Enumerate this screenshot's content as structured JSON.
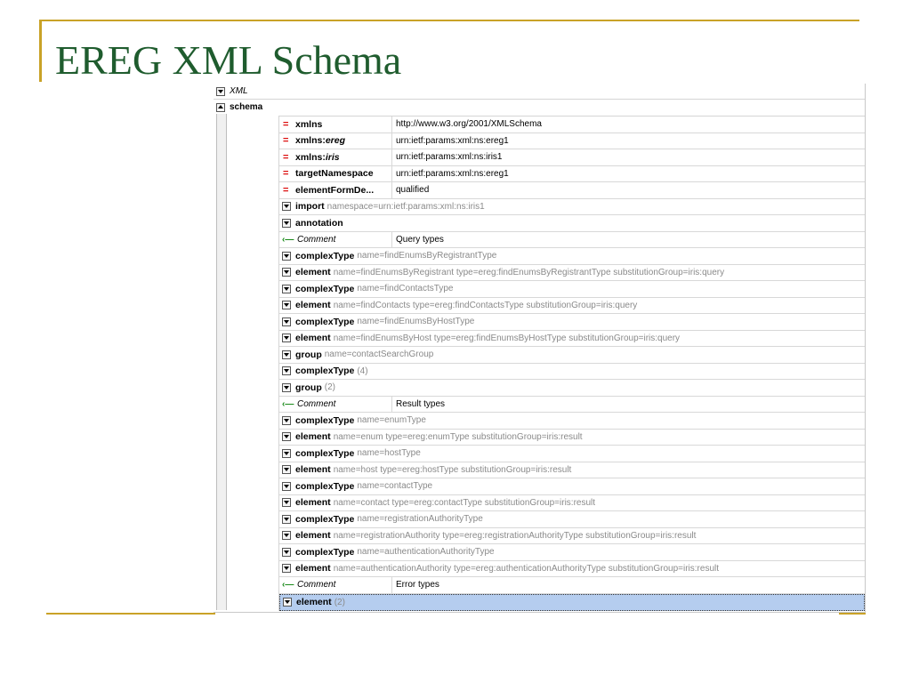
{
  "slide": {
    "title": "EREG XML Schema"
  },
  "grid": {
    "root_label": "XML",
    "schema_label": "schema",
    "attributes": [
      {
        "name": "xmlns",
        "value": "http://www.w3.org/2001/XMLSchema"
      },
      {
        "name_prefix": "xmlns:",
        "name_suffix": "ereg",
        "value": "urn:ietf:params:xml:ns:ereg1"
      },
      {
        "name_prefix": "xmlns:",
        "name_suffix": "iris",
        "value": "urn:ietf:params:xml:ns:iris1"
      },
      {
        "name": "targetNamespace",
        "value": "urn:ietf:params:xml:ns:ereg1"
      },
      {
        "name": "elementFormDe...",
        "value": "qualified"
      }
    ],
    "rows": [
      {
        "kind": "node",
        "keyword": "import",
        "attrs": "namespace=urn:ietf:params:xml:ns:iris1"
      },
      {
        "kind": "node",
        "keyword": "annotation",
        "attrs": ""
      },
      {
        "kind": "comment",
        "label": "Comment",
        "text": "Query types"
      },
      {
        "kind": "node",
        "keyword": "complexType",
        "attrs": "name=findEnumsByRegistrantType"
      },
      {
        "kind": "node",
        "keyword": "element",
        "attrs": "name=findEnumsByRegistrant type=ereg:findEnumsByRegistrantType substitutionGroup=iris:query"
      },
      {
        "kind": "node",
        "keyword": "complexType",
        "attrs": "name=findContactsType"
      },
      {
        "kind": "node",
        "keyword": "element",
        "attrs": "name=findContacts type=ereg:findContactsType substitutionGroup=iris:query"
      },
      {
        "kind": "node",
        "keyword": "complexType",
        "attrs": "name=findEnumsByHostType"
      },
      {
        "kind": "node",
        "keyword": "element",
        "attrs": "name=findEnumsByHost type=ereg:findEnumsByHostType substitutionGroup=iris:query"
      },
      {
        "kind": "node",
        "keyword": "group",
        "attrs": "name=contactSearchGroup"
      },
      {
        "kind": "node",
        "keyword": "complexType",
        "attrs": "(4)"
      },
      {
        "kind": "node",
        "keyword": "group",
        "attrs": "(2)"
      },
      {
        "kind": "comment",
        "label": "Comment",
        "text": "Result types"
      },
      {
        "kind": "node",
        "keyword": "complexType",
        "attrs": "name=enumType"
      },
      {
        "kind": "node",
        "keyword": "element",
        "attrs": "name=enum type=ereg:enumType substitutionGroup=iris:result"
      },
      {
        "kind": "node",
        "keyword": "complexType",
        "attrs": "name=hostType"
      },
      {
        "kind": "node",
        "keyword": "element",
        "attrs": "name=host type=ereg:hostType substitutionGroup=iris:result"
      },
      {
        "kind": "node",
        "keyword": "complexType",
        "attrs": "name=contactType"
      },
      {
        "kind": "node",
        "keyword": "element",
        "attrs": "name=contact type=ereg:contactType substitutionGroup=iris:result"
      },
      {
        "kind": "node",
        "keyword": "complexType",
        "attrs": "name=registrationAuthorityType"
      },
      {
        "kind": "node",
        "keyword": "element",
        "attrs": "name=registrationAuthority type=ereg:registrationAuthorityType substitutionGroup=iris:result"
      },
      {
        "kind": "node",
        "keyword": "complexType",
        "attrs": "name=authenticationAuthorityType"
      },
      {
        "kind": "node",
        "keyword": "element",
        "attrs": "name=authenticationAuthority type=ereg:authenticationAuthorityType substitutionGroup=iris:result"
      },
      {
        "kind": "comment",
        "label": "Comment",
        "text": "Error types"
      },
      {
        "kind": "node",
        "keyword": "element",
        "attrs": "(2)",
        "selected": true
      }
    ]
  },
  "colors": {
    "title": "#1f5c2e",
    "rule": "#c9a227",
    "attr_marker": "#dd1111",
    "comment_icon": "#1a8a1a",
    "selection": "#b5cdef"
  }
}
